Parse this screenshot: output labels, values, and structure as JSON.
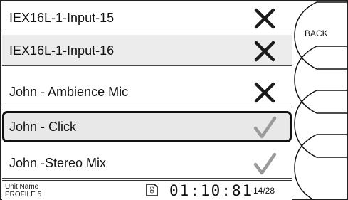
{
  "list": {
    "items": [
      {
        "label": "IEX16L-1-Input-15",
        "status": "off",
        "icon": "cross-icon"
      },
      {
        "label": "IEX16L-1-Input-16",
        "status": "off",
        "icon": "cross-icon"
      },
      {
        "label": "John - Ambience Mic",
        "status": "off",
        "icon": "cross-icon"
      },
      {
        "label": "John - Click",
        "status": "on",
        "icon": "check-icon",
        "selected": true
      },
      {
        "label": "John -Stereo Mix",
        "status": "on",
        "icon": "check-icon"
      }
    ]
  },
  "status_bar": {
    "unit_name": "Unit Name",
    "profile": "PROFILE 5",
    "sd_label": "SD",
    "timecode": "01:10:81",
    "page": "14/28"
  },
  "softkeys": {
    "back_label": "BACK"
  },
  "colors": {
    "cross": "#1a1a1a",
    "check": "#9a9a9a",
    "selected_border": "#111111"
  }
}
